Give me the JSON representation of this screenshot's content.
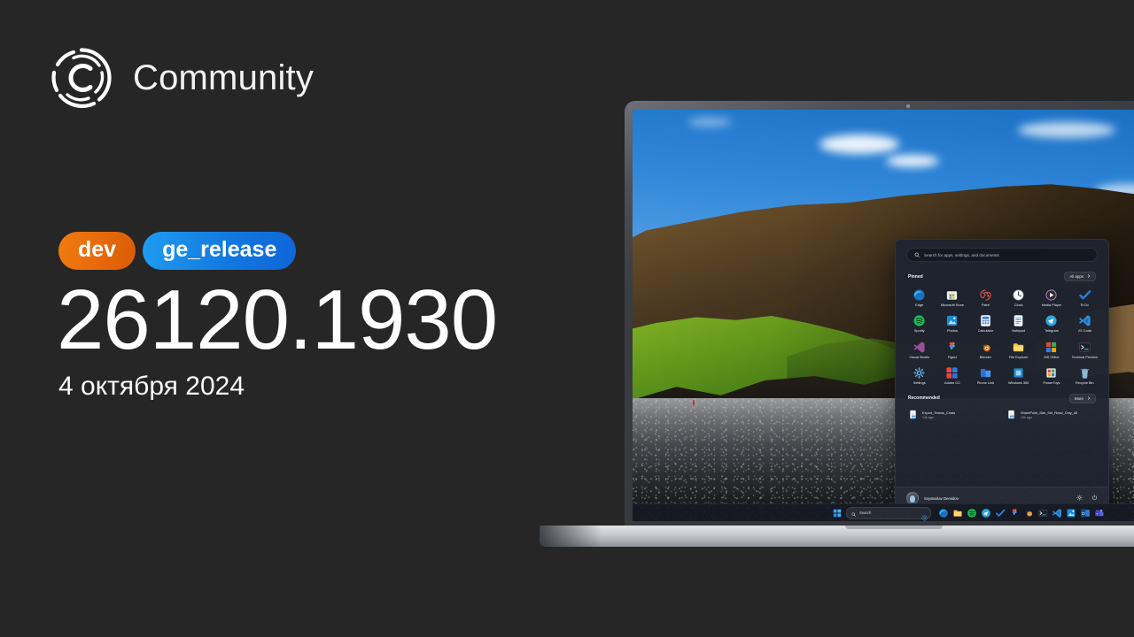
{
  "brand": {
    "logo_icon": "community-circle-logo",
    "title": "Community"
  },
  "release": {
    "badges": [
      {
        "label": "dev",
        "color": "#e8690b"
      },
      {
        "label": "ge_release",
        "color": "#1279e0"
      }
    ],
    "build": "26120.1930",
    "date": "4 октября 2024"
  },
  "device": {
    "type": "laptop",
    "webcam_icon": "webcam-dot"
  },
  "wallpaper": {
    "name": "iceland-cliff-black-beach",
    "sky_color": "#2f86d8",
    "grass_color": "#6da41e",
    "rock_color": "#4c3a22",
    "beach_color": "#2b2d31"
  },
  "start_menu": {
    "search": {
      "placeholder": "Search for apps, settings, and documents",
      "icon": "search-icon"
    },
    "pinned": {
      "title": "Pinned",
      "all_apps_label": "All apps",
      "all_apps_icon": "chevron-right-icon",
      "apps": [
        {
          "label": "Edge",
          "icon": "edge-icon"
        },
        {
          "label": "Microsoft Store",
          "icon": "microsoft-store-icon"
        },
        {
          "label": "Paint",
          "icon": "paint-icon"
        },
        {
          "label": "Clock",
          "icon": "clock-icon"
        },
        {
          "label": "Media Player",
          "icon": "media-player-icon"
        },
        {
          "label": "To Do",
          "icon": "to-do-icon"
        },
        {
          "label": "Spotify",
          "icon": "spotify-icon"
        },
        {
          "label": "Photos",
          "icon": "photos-icon"
        },
        {
          "label": "Calculator",
          "icon": "calculator-icon"
        },
        {
          "label": "Notepad",
          "icon": "notepad-icon"
        },
        {
          "label": "Telegram",
          "icon": "telegram-icon"
        },
        {
          "label": "VS Code",
          "icon": "vs-code-icon"
        },
        {
          "label": "Visual Studio",
          "icon": "visual-studio-icon"
        },
        {
          "label": "Figma",
          "icon": "figma-icon"
        },
        {
          "label": "Blender",
          "icon": "blender-icon"
        },
        {
          "label": "File Explorer",
          "icon": "file-explorer-icon"
        },
        {
          "label": "MS Office",
          "icon": "ms-office-icon"
        },
        {
          "label": "Terminal Preview",
          "icon": "terminal-preview-icon"
        },
        {
          "label": "Settings",
          "icon": "settings-icon"
        },
        {
          "label": "Adobe CC",
          "icon": "adobe-cc-icon"
        },
        {
          "label": "Phone Link",
          "icon": "phone-link-icon"
        },
        {
          "label": "Windows 365",
          "icon": "windows-365-icon"
        },
        {
          "label": "PowerToys",
          "icon": "powertoys-icon"
        },
        {
          "label": "Recycle Bin",
          "icon": "recycle-bin-icon"
        }
      ]
    },
    "recommended": {
      "title": "Recommended",
      "more_label": "More",
      "more_icon": "chevron-right-icon",
      "items": [
        {
          "name": "Export_Teams_Chats",
          "subtitle": "14h ago",
          "icon": "document-icon"
        },
        {
          "name": "SharePoint_Site_Set_Read_Only_All",
          "subtitle": "15h ago",
          "icon": "document-icon"
        }
      ]
    },
    "footer": {
      "user_name": "Svyatoslav Demidov",
      "avatar_icon": "avatar",
      "settings_icon": "gear-icon",
      "power_icon": "power-icon"
    }
  },
  "taskbar": {
    "start_icon": "windows-start-icon",
    "search_label": "Search",
    "search_icon": "search-icon",
    "copilot_icon": "copilot-icon",
    "apps": [
      {
        "icon": "edge-icon"
      },
      {
        "icon": "file-explorer-icon"
      },
      {
        "icon": "spotify-icon"
      },
      {
        "icon": "telegram-icon"
      },
      {
        "icon": "to-do-icon"
      },
      {
        "icon": "figma-icon"
      },
      {
        "icon": "blender-icon"
      },
      {
        "icon": "terminal-icon"
      },
      {
        "icon": "vs-code-icon"
      },
      {
        "icon": "photos-icon"
      },
      {
        "icon": "outlook-icon"
      },
      {
        "icon": "teams-icon"
      }
    ]
  }
}
